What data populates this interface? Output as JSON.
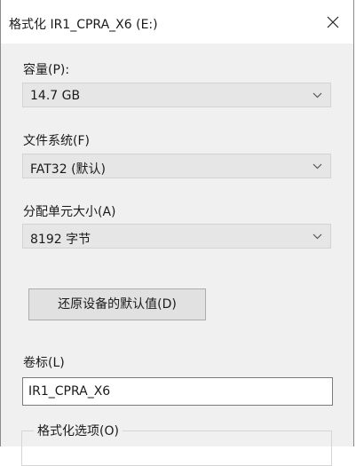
{
  "window": {
    "title": "格式化 IR1_CPRA_X6 (E:)"
  },
  "capacity": {
    "label": "容量(P):",
    "value": "14.7 GB"
  },
  "filesystem": {
    "label": "文件系统(F)",
    "value": "FAT32 (默认)"
  },
  "allocation": {
    "label": "分配单元大小(A)",
    "value": "8192 字节"
  },
  "restore_button": {
    "label": "还原设备的默认值(D)"
  },
  "volume": {
    "label": "卷标(L)",
    "value": "IR1_CPRA_X6"
  },
  "format_options": {
    "label": "格式化选项(O)"
  },
  "icons": {
    "close": "close-icon",
    "dropdown": "chevron-down-icon"
  }
}
